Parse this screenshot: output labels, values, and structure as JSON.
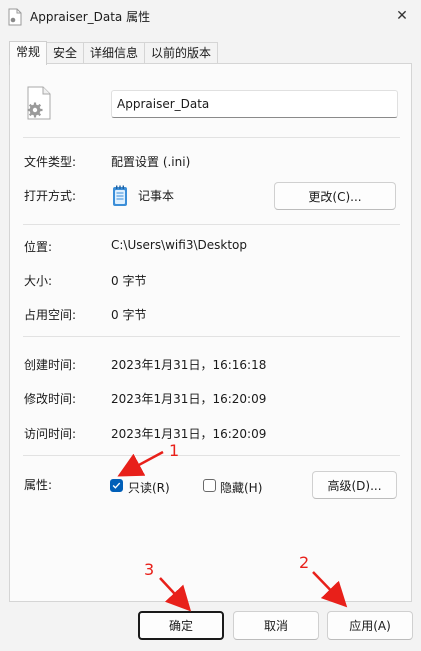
{
  "window": {
    "title": "Appraiser_Data 属性",
    "close_glyph": "✕"
  },
  "tabs": [
    {
      "label": "常规",
      "active": true
    },
    {
      "label": "安全"
    },
    {
      "label": "详细信息"
    },
    {
      "label": "以前的版本"
    }
  ],
  "general": {
    "file_name": "Appraiser_Data",
    "file_type": {
      "label": "文件类型:",
      "value": "配置设置 (.ini)"
    },
    "opens_with": {
      "label": "打开方式:",
      "app": "记事本",
      "change_button": "更改(C)..."
    },
    "location": {
      "label": "位置:",
      "value": "C:\\Users\\wifi3\\Desktop"
    },
    "size": {
      "label": "大小:",
      "value": "0 字节"
    },
    "size_on_disk": {
      "label": "占用空间:",
      "value": "0 字节"
    },
    "created": {
      "label": "创建时间:",
      "value": "2023年1月31日，16:16:18"
    },
    "modified": {
      "label": "修改时间:",
      "value": "2023年1月31日，16:20:09"
    },
    "accessed": {
      "label": "访问时间:",
      "value": "2023年1月31日，16:20:09"
    },
    "attributes": {
      "label": "属性:",
      "readonly": {
        "label": "只读(R)",
        "checked": true
      },
      "hidden": {
        "label": "隐藏(H)",
        "checked": false
      },
      "advanced_button": "高级(D)..."
    }
  },
  "footer": {
    "ok": "确定",
    "cancel": "取消",
    "apply": "应用(A)"
  },
  "annotations": {
    "one": "1",
    "two": "2",
    "three": "3",
    "color": "#e8201a"
  },
  "colors": {
    "accent": "#005fb8",
    "window_bg": "#f3f3f3",
    "panel_bg": "#fbfbfb"
  }
}
